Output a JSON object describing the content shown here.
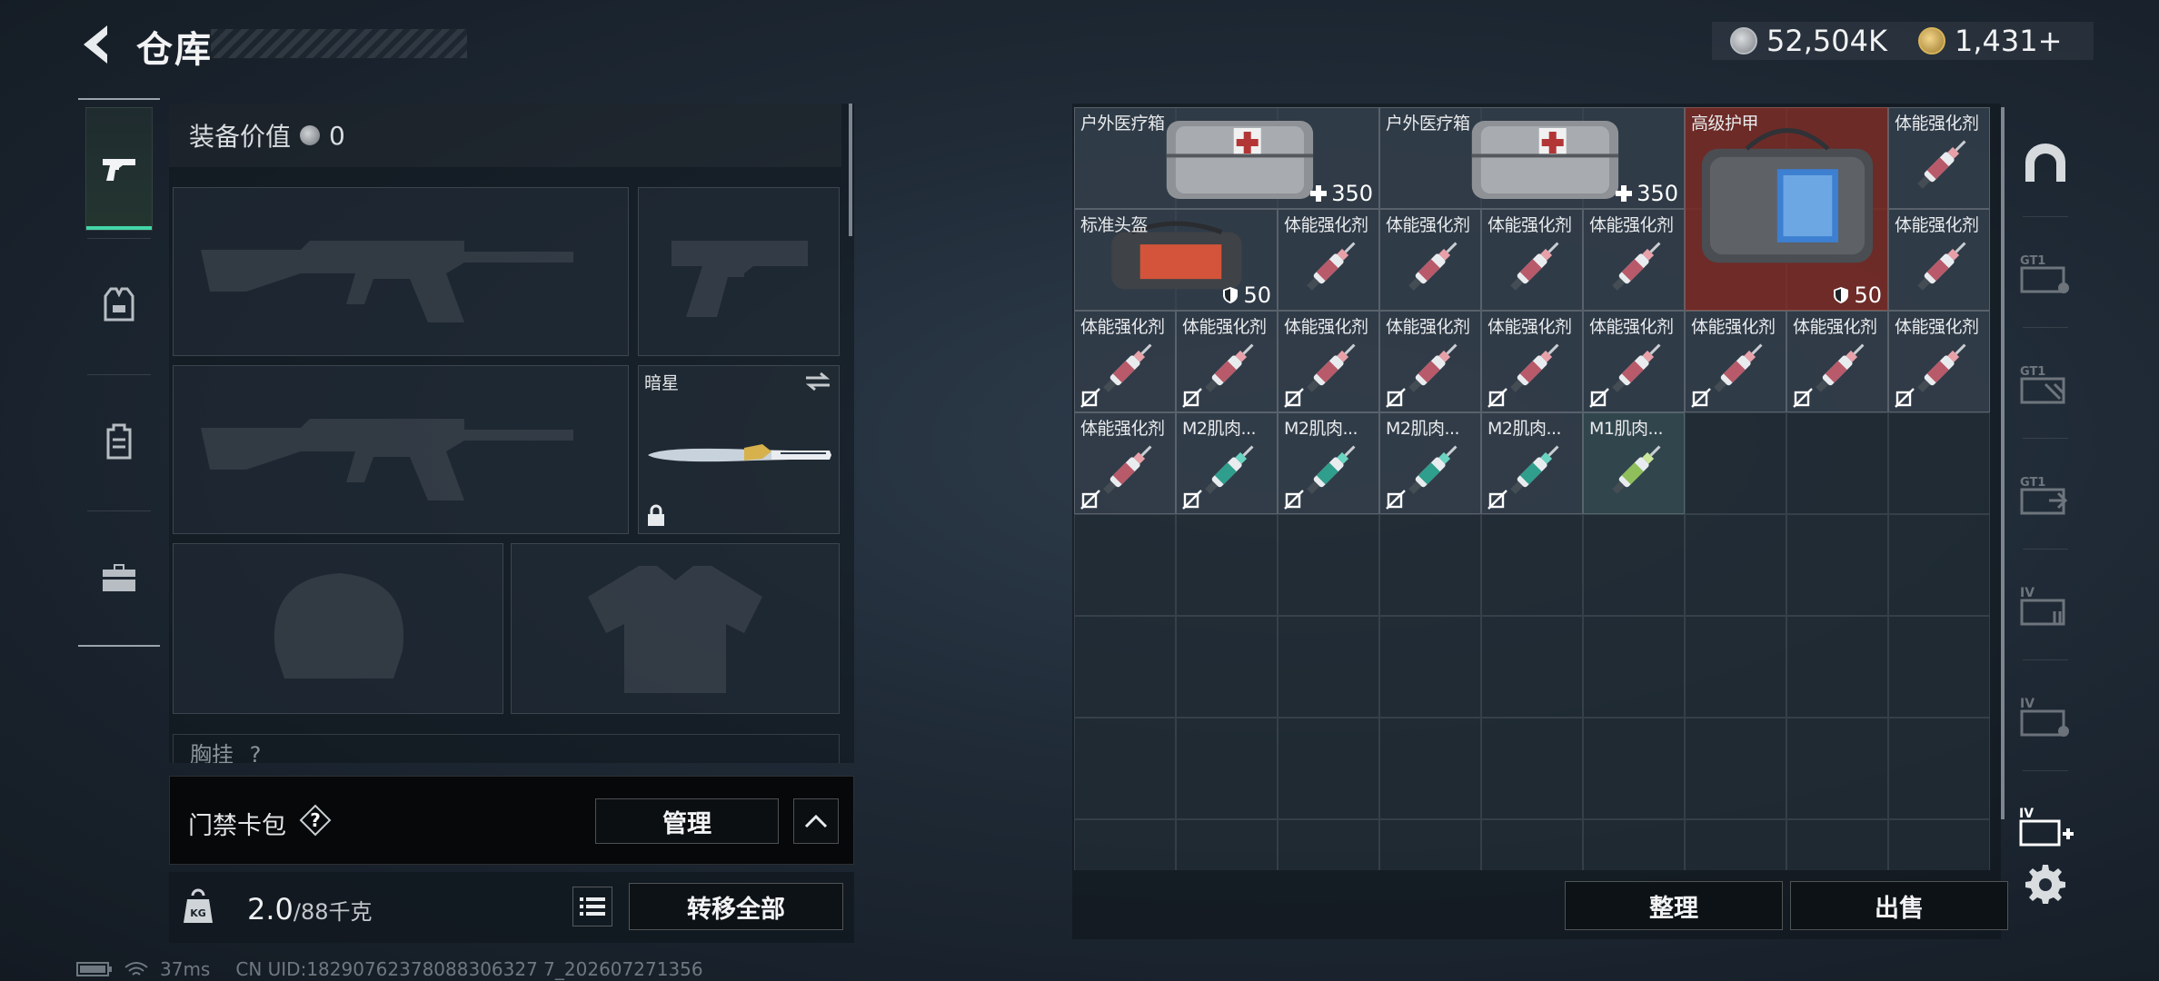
{
  "header": {
    "title": "仓库",
    "silver_currency": "52,504K",
    "gold_currency": "1,431+"
  },
  "left_nav": {
    "items": [
      {
        "name": "weapons",
        "icon": "pistol-icon",
        "active": true
      },
      {
        "name": "armor",
        "icon": "vest-icon",
        "active": false
      },
      {
        "name": "backpack",
        "icon": "backpack-icon",
        "active": false
      },
      {
        "name": "cases",
        "icon": "toolbox-icon",
        "active": false
      }
    ]
  },
  "equipment": {
    "value_label": "装备价值",
    "value": "0",
    "knife_name": "暗星",
    "chest_label": "胸挂",
    "chest_count": "?"
  },
  "card_bag": {
    "label": "门禁卡包",
    "help": "?",
    "manage_label": "管理"
  },
  "weight": {
    "current": "2.0",
    "max": "/88千克"
  },
  "transfer_all_label": "转移全部",
  "status": {
    "ping": "37ms",
    "uid": "CN UID:18290762378088306327 7_202607271356"
  },
  "storage": {
    "items": [
      {
        "name": "户外医疗箱",
        "value": "350",
        "badge": "plus",
        "kind": "medkit"
      },
      {
        "name": "户外医疗箱",
        "value": "350",
        "badge": "plus",
        "kind": "medkit"
      },
      {
        "name": "高级护甲",
        "value": "50",
        "badge": "shield",
        "kind": "armorbag"
      },
      {
        "name": "体能强化剂",
        "kind": "syringe-red"
      },
      {
        "name": "标准头盔",
        "value": "50",
        "badge": "shield",
        "kind": "helmetbag"
      },
      {
        "name": "体能强化剂",
        "kind": "syringe-red"
      },
      {
        "name": "体能强化剂",
        "kind": "syringe-red"
      },
      {
        "name": "体能强化剂",
        "kind": "syringe-red"
      },
      {
        "name": "体能强化剂",
        "kind": "syringe-red"
      },
      {
        "name": "体能强化剂",
        "kind": "syringe-red"
      },
      {
        "name": "体能强化剂",
        "kind": "syringe-red",
        "locked": true
      },
      {
        "name": "体能强化剂",
        "kind": "syringe-red",
        "locked": true
      },
      {
        "name": "体能强化剂",
        "kind": "syringe-red",
        "locked": true
      },
      {
        "name": "体能强化剂",
        "kind": "syringe-red",
        "locked": true
      },
      {
        "name": "体能强化剂",
        "kind": "syringe-red",
        "locked": true
      },
      {
        "name": "体能强化剂",
        "kind": "syringe-red",
        "locked": true
      },
      {
        "name": "体能强化剂",
        "kind": "syringe-red",
        "locked": true
      },
      {
        "name": "体能强化剂",
        "kind": "syringe-red",
        "locked": true
      },
      {
        "name": "体能强化剂",
        "kind": "syringe-red",
        "locked": true
      },
      {
        "name": "体能强化剂",
        "kind": "syringe-red",
        "locked": true
      },
      {
        "name": "M2肌肉...",
        "kind": "syringe-teal",
        "locked": true
      },
      {
        "name": "M2肌肉...",
        "kind": "syringe-teal",
        "locked": true
      },
      {
        "name": "M2肌肉...",
        "kind": "syringe-teal",
        "locked": true
      },
      {
        "name": "M2肌肉...",
        "kind": "syringe-teal",
        "locked": true
      },
      {
        "name": "M1肌肉...",
        "kind": "syringe-green"
      }
    ],
    "sort_label": "整理",
    "sell_label": "出售"
  },
  "right_tabs": [
    {
      "name": "all",
      "icon": "arch-icon"
    },
    {
      "name": "gt1-a",
      "icon": "storage-gt1-icon"
    },
    {
      "name": "gt1-b",
      "icon": "storage-gt1-icon"
    },
    {
      "name": "gt1-c",
      "icon": "storage-gt1-icon"
    },
    {
      "name": "iv-a",
      "icon": "storage-iv-icon"
    },
    {
      "name": "iv-b",
      "icon": "storage-iv-icon"
    },
    {
      "name": "iv-add",
      "icon": "storage-iv-add-icon"
    }
  ],
  "colors": {
    "accent_green": "#43d6a7",
    "rare_red": "#842c24"
  }
}
